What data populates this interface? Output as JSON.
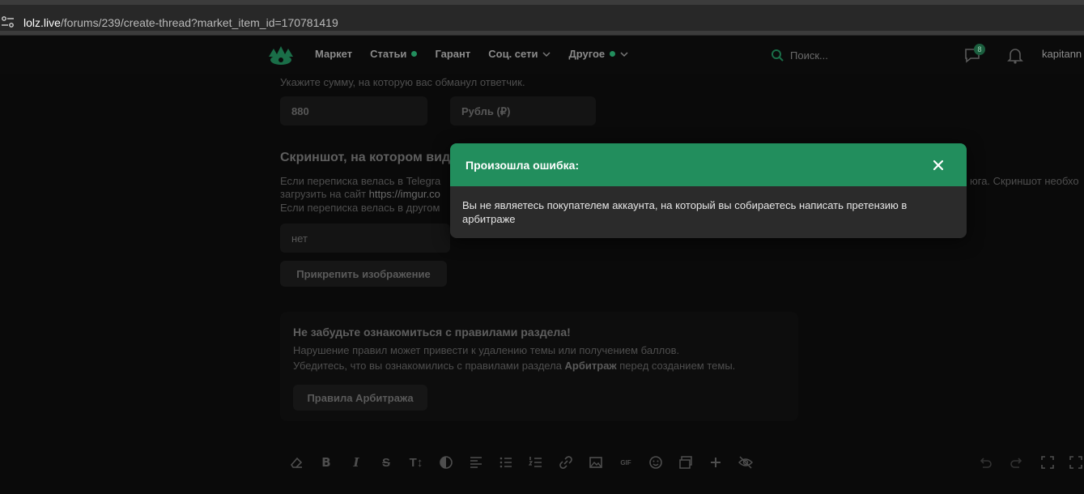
{
  "browser": {
    "url_host": "lolz.live",
    "url_path": "/forums/239/create-thread?market_item_id=170781419"
  },
  "header": {
    "nav": [
      {
        "label": "Маркет",
        "dot": false,
        "chevron": false
      },
      {
        "label": "Статьи",
        "dot": true,
        "chevron": false
      },
      {
        "label": "Гарант",
        "dot": false,
        "chevron": false
      },
      {
        "label": "Соц. сети",
        "dot": false,
        "chevron": true
      },
      {
        "label": "Другое",
        "dot": true,
        "chevron": true
      }
    ],
    "search_placeholder": "Поиск...",
    "messages_badge": "8",
    "username": "kapitann"
  },
  "form": {
    "amount_hint": "Укажите сумму, на которую вас обманул ответчик.",
    "amount_value": "880",
    "currency_value": "Рубль (₽)",
    "screenshot_heading": "Скриншот, на котором вид",
    "screenshot_desc_line1_start": "Если переписка велась в Telegra",
    "screenshot_desc_line1_end": "юга. Скриншот необхо",
    "screenshot_desc_line2_prefix": "загрузить на сайт ",
    "screenshot_desc_line2_link": "https://imgur.co",
    "screenshot_desc_line3": "Если переписка велась в другом",
    "screenshot_value": "нет",
    "attach_button": "Прикрепить изображение"
  },
  "rules": {
    "title": "Не забудьте ознакомиться с правилами раздела!",
    "line1": "Нарушение правил может привести к удалению темы или получением баллов.",
    "line2_prefix": "Убедитесь, что вы ознакомились с правилами раздела ",
    "line2_bold": "Арбитраж",
    "line2_suffix": " перед созданием темы.",
    "button": "Правила Арбитража"
  },
  "editor": {
    "toolbar_text_size_label": "T↕",
    "gif_label": "GIF"
  },
  "modal": {
    "title": "Произошла ошибка:",
    "message": "Вы не являетесь покупателем аккаунта, на который вы собираетесь написать претензию в арбитраже"
  },
  "colors": {
    "accent": "#228e5d",
    "modal_bg": "#2b2b2b",
    "page_bg": "#0a0a0a"
  },
  "icons": {
    "header": [
      "logo-eye-icon",
      "search-icon",
      "chat-icon",
      "bell-icon"
    ],
    "toolbar": [
      "eraser-icon",
      "bold-icon",
      "italic-icon",
      "strikethrough-icon",
      "text-size-icon",
      "contrast-icon",
      "align-left-icon",
      "bullet-list-icon",
      "numbered-list-icon",
      "link-icon",
      "image-icon",
      "gif-icon",
      "emoji-icon",
      "gallery-icon",
      "plus-icon",
      "hidden-icon",
      "undo-icon",
      "redo-icon",
      "fullscreen-icon"
    ]
  }
}
